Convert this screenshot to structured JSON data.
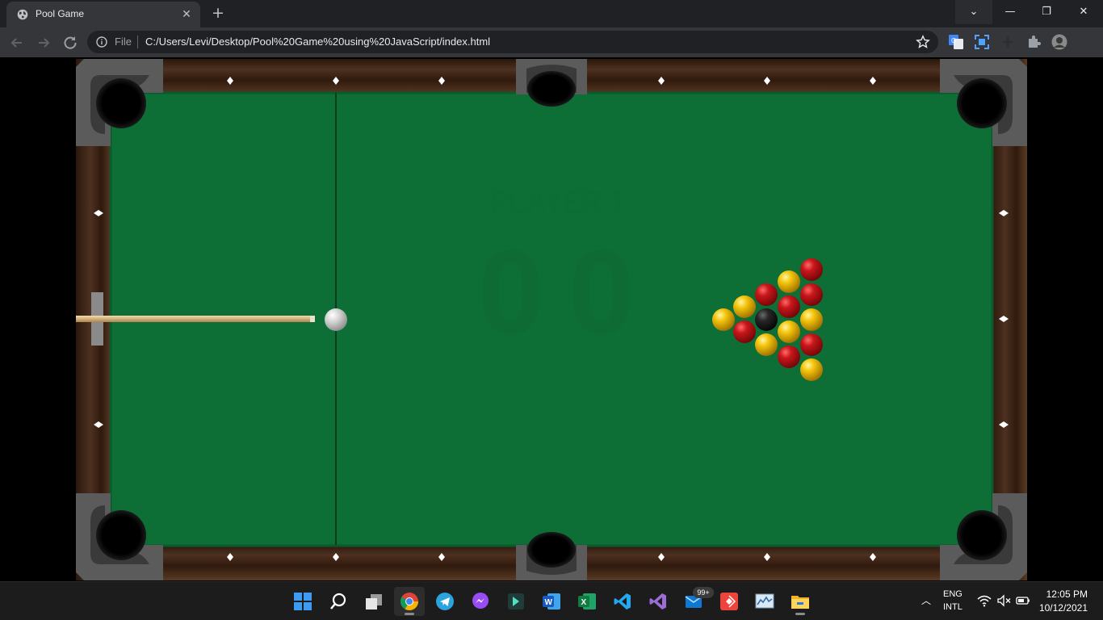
{
  "browser": {
    "tab": {
      "title": "Pool Game",
      "close_glyph": "✕",
      "favicon": "globe-icon"
    },
    "new_tab_glyph": "+",
    "window_controls": {
      "tab_search": "⌄",
      "minimize": "—",
      "restore": "❐",
      "close": "✕"
    },
    "omnibox": {
      "scheme": "File",
      "url": "C:/Users/Levi/Desktop/Pool%20Game%20using%20JavaScript/index.html"
    }
  },
  "game": {
    "player_label": "PLAYER 1",
    "score_left": "0",
    "score_right": "0",
    "colors": {
      "felt": "#0d6e36",
      "wood": "#3a2414",
      "red_ball": "#c0161a",
      "yellow_ball": "#f3c60d",
      "black_ball": "#222222",
      "cue_ball": "#d6d6d6"
    }
  },
  "taskbar": {
    "apps": [
      "windows-start-icon",
      "search-icon",
      "task-view-icon",
      "chrome-icon",
      "telegram-icon",
      "messenger-icon",
      "filmora-icon",
      "word-icon",
      "excel-icon",
      "vscode-icon",
      "visual-studio-icon",
      "mail-icon",
      "anydesk-icon",
      "resource-monitor-icon",
      "file-explorer-icon"
    ],
    "mail_badge": "99+",
    "tray_chevron": "︿",
    "lang_line1": "ENG",
    "lang_line2": "INTL",
    "time": "12:05 PM",
    "date": "10/12/2021"
  }
}
